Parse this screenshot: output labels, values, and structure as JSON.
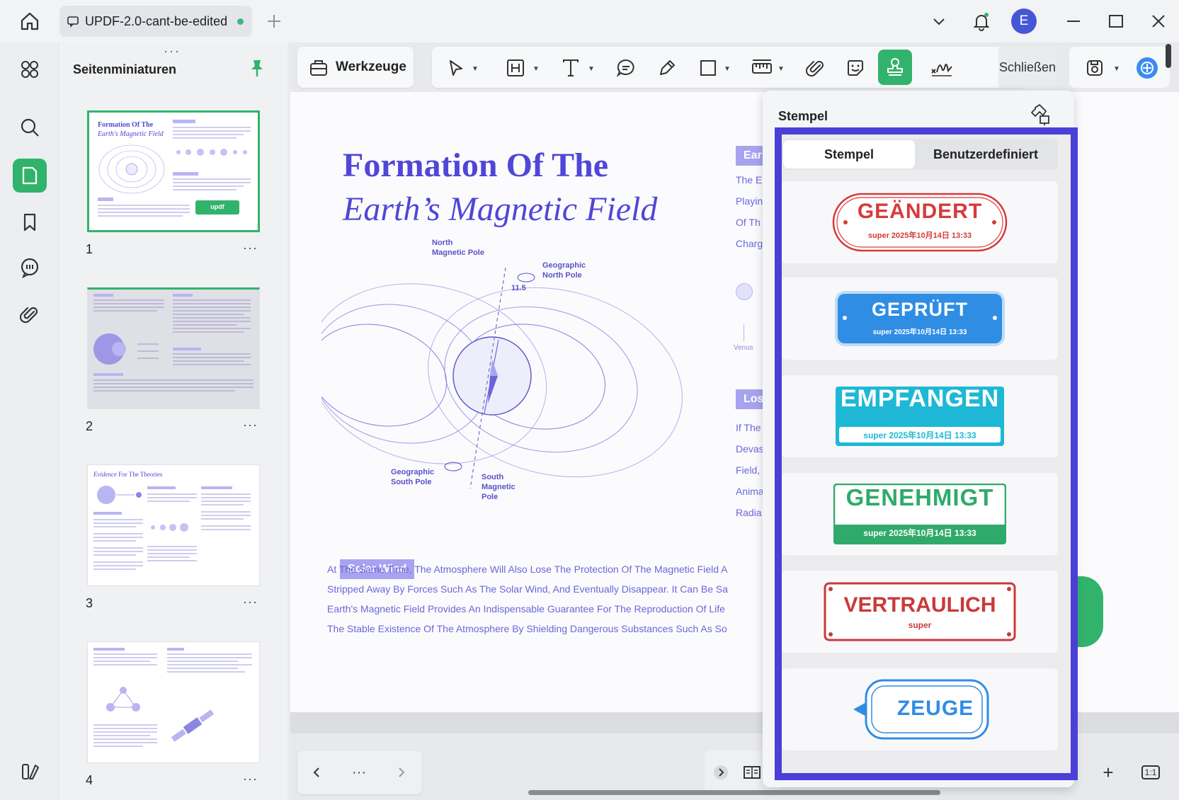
{
  "tab": {
    "title": "UPDF-2.0-cant-be-edited"
  },
  "thumbnails": {
    "panel_title": "Seitenminiaturen",
    "pages": [
      {
        "number": "1",
        "more": "···"
      },
      {
        "number": "2",
        "more": "···"
      },
      {
        "number": "3",
        "more": "···"
      },
      {
        "number": "4",
        "more": "···"
      }
    ],
    "thumb1_title": "Formation Of The",
    "thumb1_subtitle": "Earth's Magnetic Field",
    "thumb1_button": "updf",
    "thumb3_title_em": "Evidence",
    "thumb3_title": " For The Theories"
  },
  "toolbar": {
    "tools_label": "Werkzeuge",
    "close_label": "Schließen"
  },
  "document": {
    "title_line1": "Formation Of The",
    "title_line2": "Earth’s Magnetic Field",
    "labels": {
      "north_magnetic": "North\nMagnetic Pole",
      "geo_north": "Geographic\nNorth Pole",
      "angle": "11.5",
      "geo_south": "Geographic\nSouth Pole",
      "south_magnetic": "South\nMagnetic\nPole",
      "venus": "Venus"
    },
    "section_solar_wind": "Solar Wind",
    "section_right_top": "Ear",
    "section_right_mid": "Los",
    "body_lines": [
      "At The Same Time, The Atmosphere Will Also Lose The Protection Of The Magnetic Field A",
      "Stripped Away By Forces Such As The Solar Wind, And Eventually Disappear. It Can Be Sa",
      "Earth's Magnetic Field Provides An Indispensable Guarantee For The Reproduction Of Life",
      "The Stable Existence Of The Atmosphere By Shielding Dangerous Substances Such As So"
    ],
    "side_lines_top": [
      "The E",
      "Playin",
      "Of Th",
      "Charg"
    ],
    "side_lines_bottom": [
      "If The",
      "Devas",
      "Field,",
      "Anima",
      "Radia"
    ]
  },
  "stamp_panel": {
    "title": "Stempel",
    "tabs": [
      "Stempel",
      "Benutzerdefiniert"
    ],
    "stamps": [
      {
        "name": "GEÄNDERT",
        "sub": "super 2025年10月14日 13:33",
        "color": "#d63a3a"
      },
      {
        "name": "GEPRÜFT",
        "sub": "super 2025年10月14日 13:33",
        "color": "#2f8de4"
      },
      {
        "name": "EMPFANGEN",
        "sub": "super 2025年10月14日 13:33",
        "color": "#1eb8d6"
      },
      {
        "name": "GENEHMIGT",
        "sub": "super 2025年10月14日 13:33",
        "color": "#2faa6a"
      },
      {
        "name": "VERTRAULICH",
        "sub": "super",
        "color": "#c93a3a"
      },
      {
        "name": "ZEUGE",
        "sub": "",
        "color": "#2f8de4"
      }
    ]
  },
  "navigation": {
    "more": "···"
  },
  "status": {
    "plus": "+",
    "fit": "1:1"
  },
  "colors": {
    "accent": "#32b36c",
    "doc_purple": "#5046d8",
    "frame": "#4a3fd6"
  }
}
